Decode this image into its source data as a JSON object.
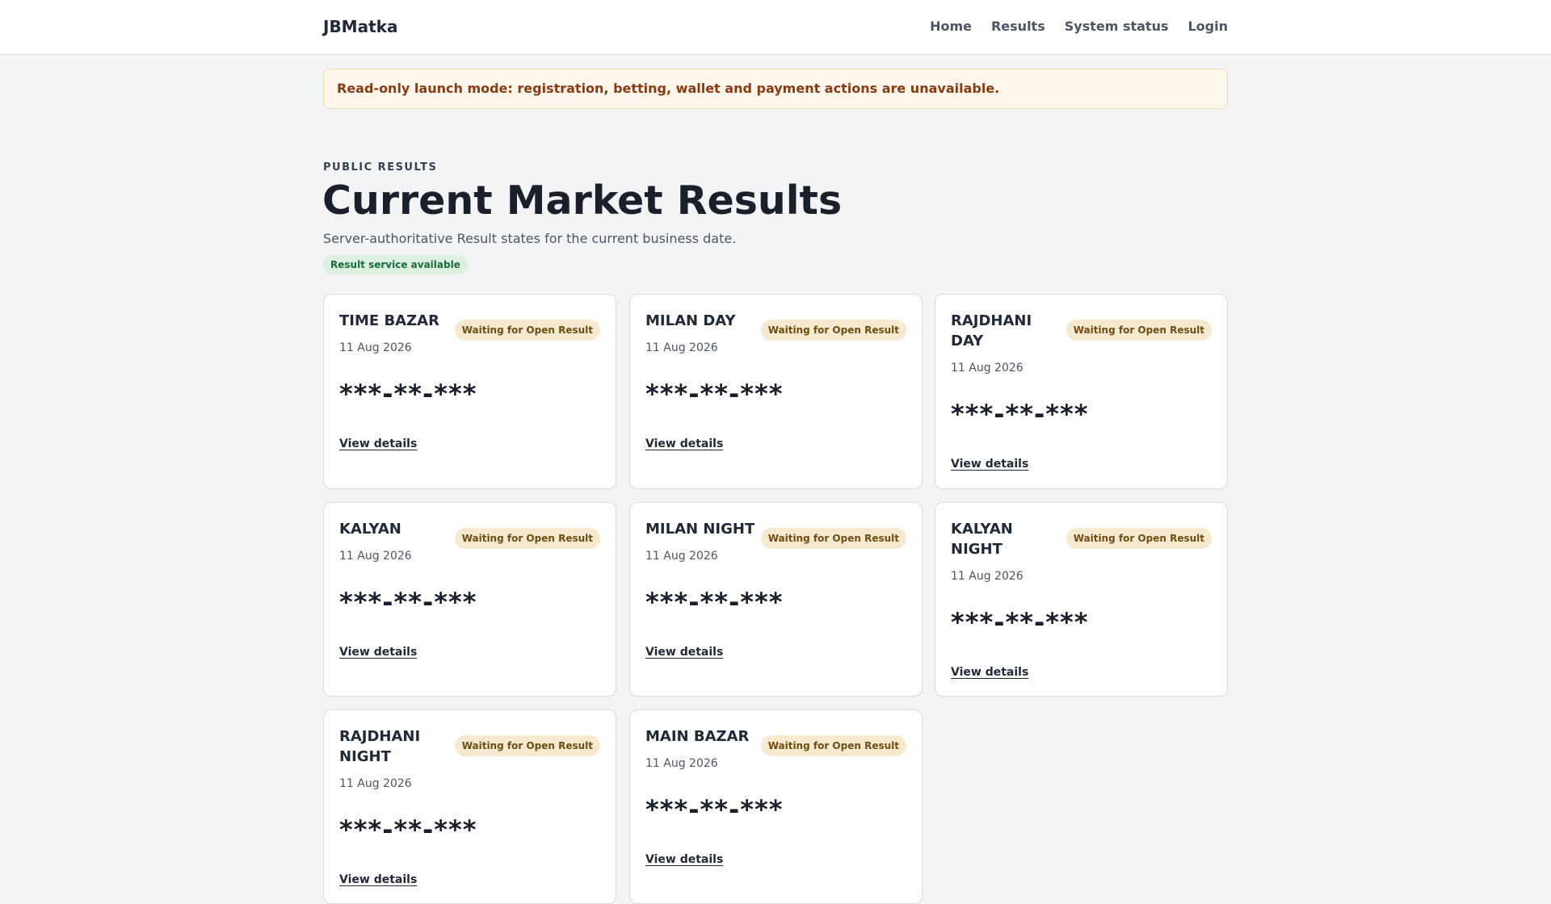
{
  "header": {
    "brand": "JBMatka",
    "nav": [
      "Home",
      "Results",
      "System status",
      "Login"
    ]
  },
  "notice": "Read-only launch mode: registration, betting, wallet and payment actions are unavailable.",
  "page": {
    "eyebrow": "PUBLIC RESULTS",
    "title": "Current Market Results",
    "subtitle": "Server-authoritative Result states for the current business date.",
    "service_badge": "Result service available"
  },
  "cards": [
    {
      "name": "TIME BAZAR",
      "status": "Waiting for Open Result",
      "date": "11 Aug 2026",
      "result": "***-**-***",
      "link": "View details"
    },
    {
      "name": "MILAN DAY",
      "status": "Waiting for Open Result",
      "date": "11 Aug 2026",
      "result": "***-**-***",
      "link": "View details"
    },
    {
      "name": "RAJDHANI DAY",
      "status": "Waiting for Open Result",
      "date": "11 Aug 2026",
      "result": "***-**-***",
      "link": "View details"
    },
    {
      "name": "KALYAN",
      "status": "Waiting for Open Result",
      "date": "11 Aug 2026",
      "result": "***-**-***",
      "link": "View details"
    },
    {
      "name": "MILAN NIGHT",
      "status": "Waiting for Open Result",
      "date": "11 Aug 2026",
      "result": "***-**-***",
      "link": "View details"
    },
    {
      "name": "KALYAN NIGHT",
      "status": "Waiting for Open Result",
      "date": "11 Aug 2026",
      "result": "***-**-***",
      "link": "View details"
    },
    {
      "name": "RAJDHANI NIGHT",
      "status": "Waiting for Open Result",
      "date": "11 Aug 2026",
      "result": "***-**-***",
      "link": "View details"
    },
    {
      "name": "MAIN BAZAR",
      "status": "Waiting for Open Result",
      "date": "11 Aug 2026",
      "result": "***-**-***",
      "link": "View details"
    }
  ],
  "colors": {
    "background": "#f3f4f6",
    "notice_bg": "#fff7ec",
    "notice_text": "#8a3a12",
    "status_bg": "#f5ead0",
    "status_text": "#6e4d12",
    "service_bg": "#dcefe1",
    "service_text": "#1e6b3a"
  }
}
